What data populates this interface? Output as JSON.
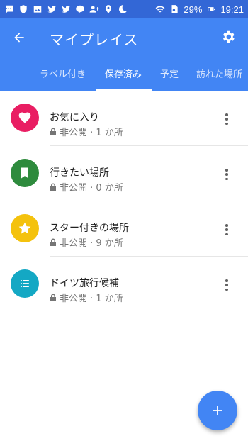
{
  "status_bar": {
    "battery": "29%",
    "time": "19:21"
  },
  "app_bar": {
    "title": "マイプレイス",
    "back_icon": "arrow-back-icon",
    "settings_icon": "gear-icon"
  },
  "tabs": [
    {
      "label": "ラベル付き",
      "active": false
    },
    {
      "label": "保存済み",
      "active": true
    },
    {
      "label": "予定",
      "active": false
    },
    {
      "label": "訪れた場所",
      "active": false
    }
  ],
  "lists": [
    {
      "name": "お気に入り",
      "meta": "非公開 · 1 か所",
      "icon": "heart-icon",
      "color": "#e91e63"
    },
    {
      "name": "行きたい場所",
      "meta": "非公開 · 0 か所",
      "icon": "bookmark-icon",
      "color": "#2e8b3d"
    },
    {
      "name": "スター付きの場所",
      "meta": "非公開 · 9 か所",
      "icon": "star-icon",
      "color": "#f4c20d"
    },
    {
      "name": "ドイツ旅行候補",
      "meta": "非公開 · 1 か所",
      "icon": "list-icon",
      "color": "#14a8c4"
    }
  ],
  "fab": {
    "icon": "plus-icon"
  },
  "colors": {
    "status_bar": "#3367d6",
    "app_bar": "#4285f4",
    "fab": "#4285f4"
  }
}
